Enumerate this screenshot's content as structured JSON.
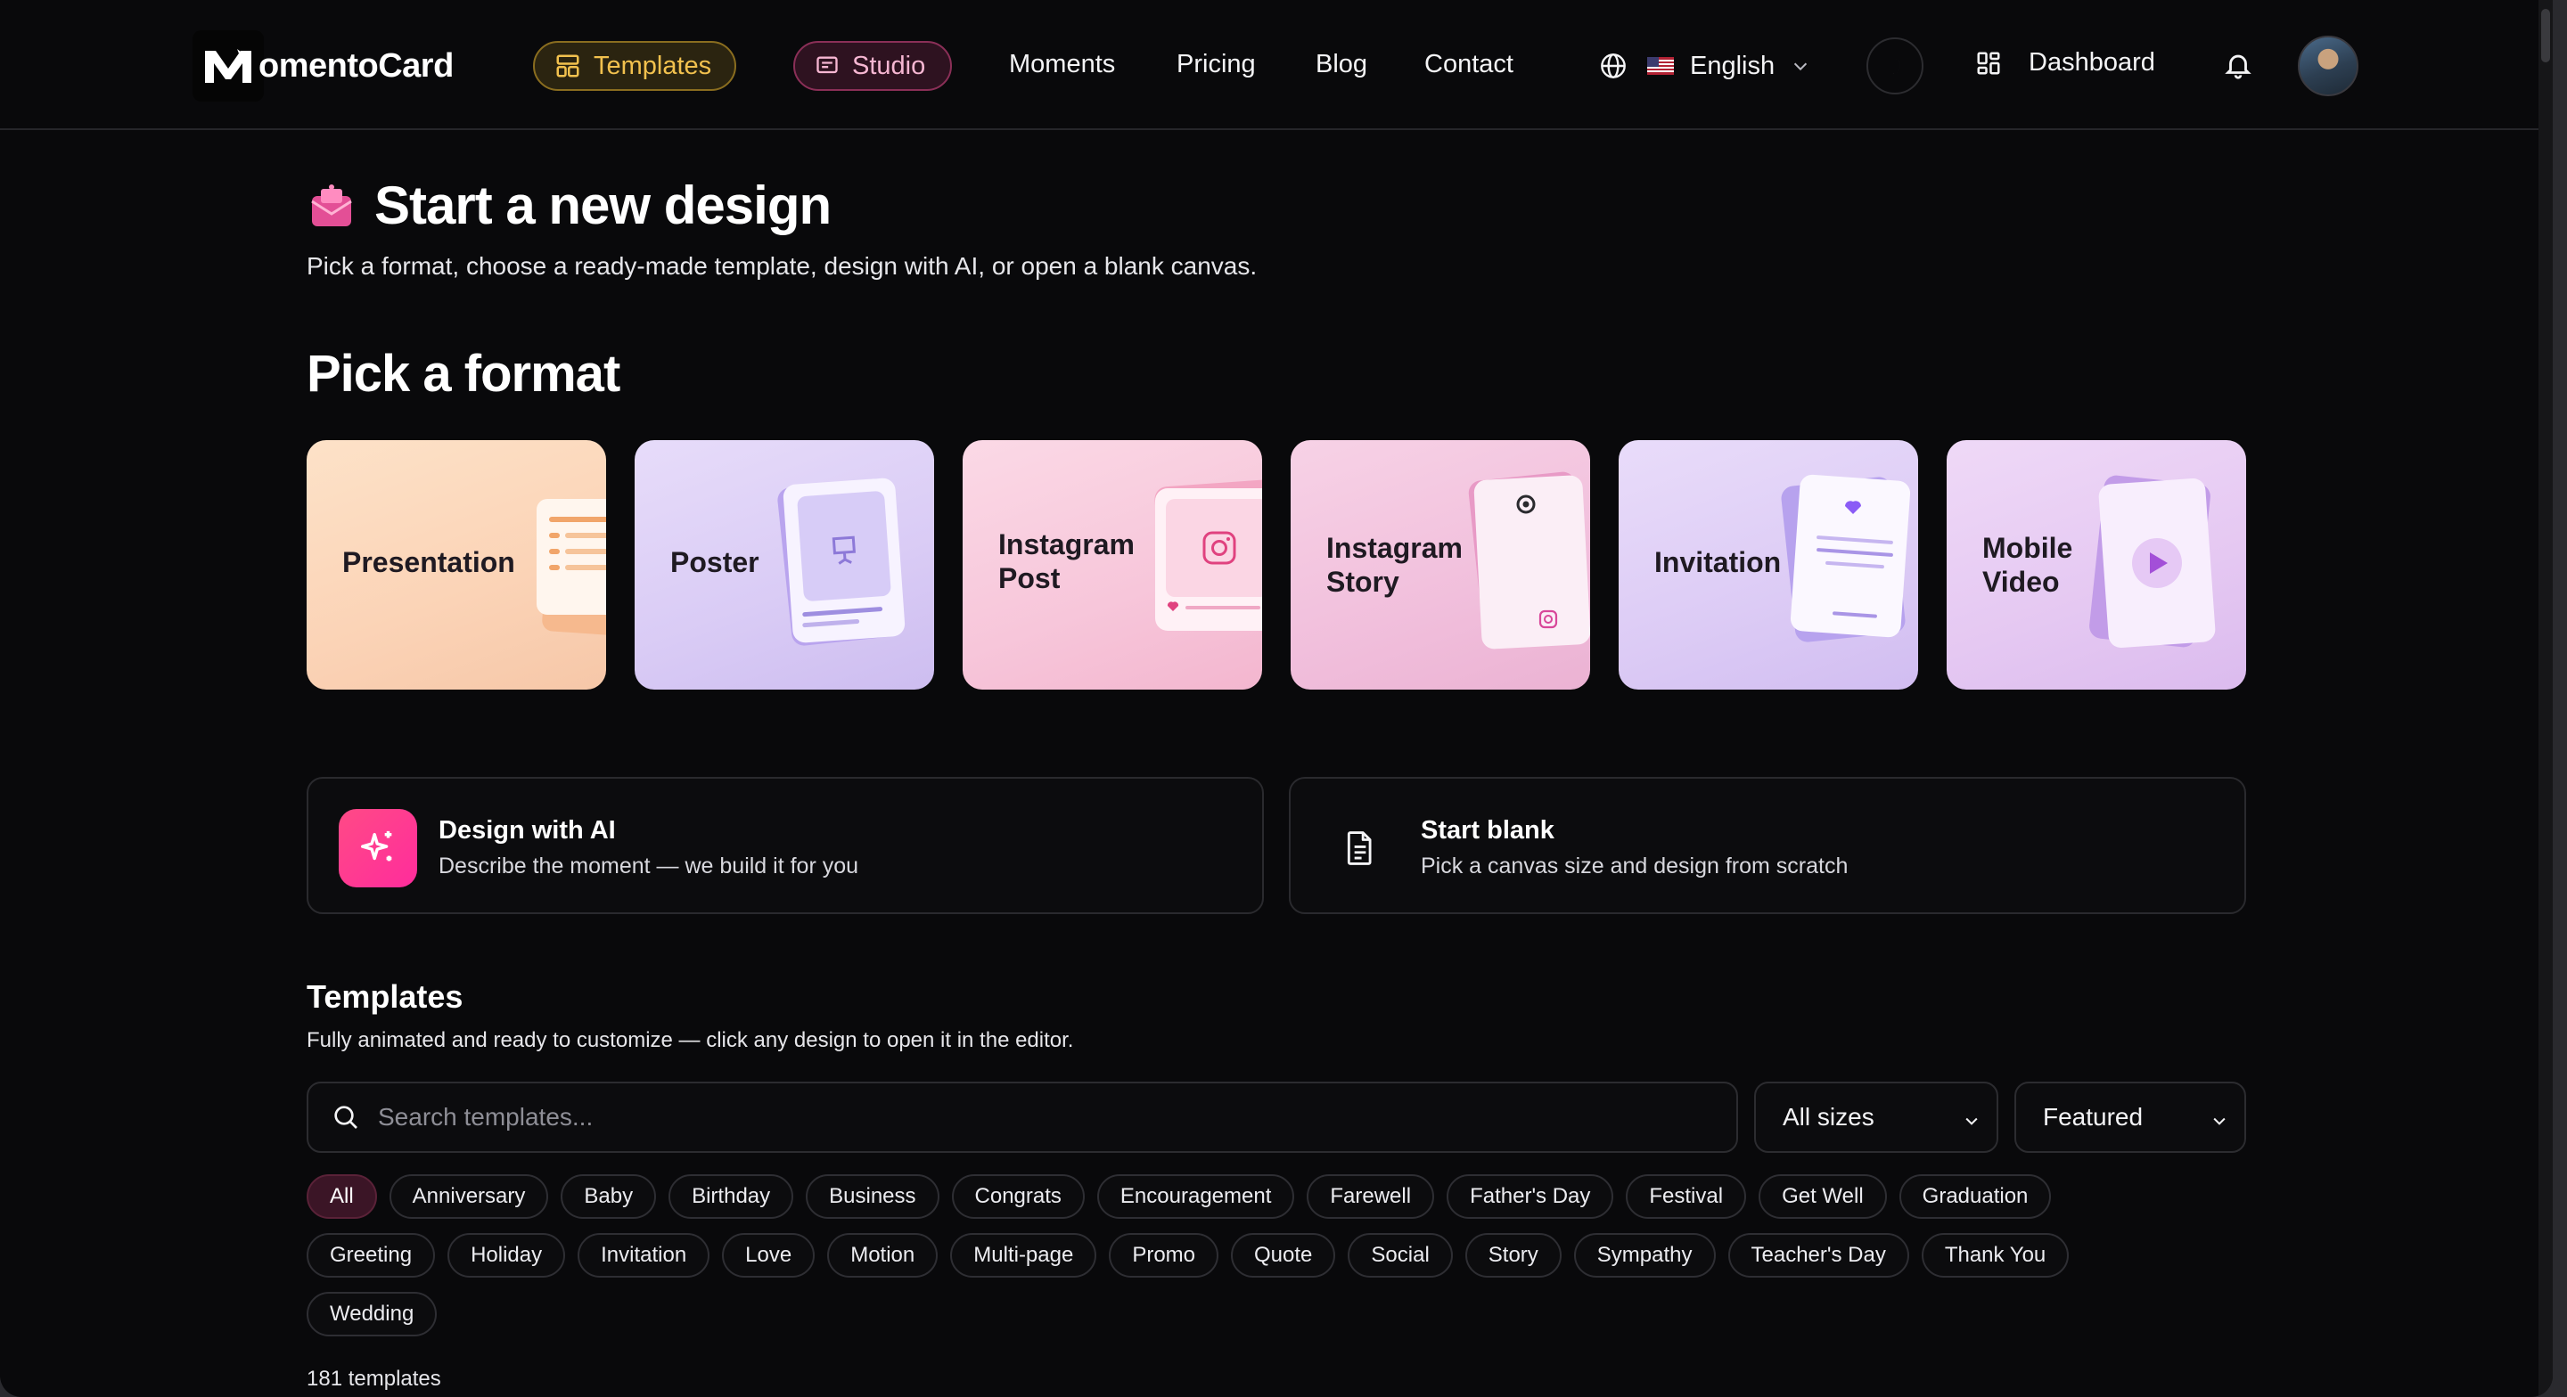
{
  "brand": {
    "name": "omentoCard",
    "logo_letter": "M"
  },
  "nav": {
    "templates": "Templates",
    "studio": "Studio",
    "links": [
      "Moments",
      "Pricing",
      "Blog",
      "Contact"
    ],
    "language": "English",
    "dashboard": "Dashboard"
  },
  "hero": {
    "title": "Start a new design",
    "subtitle": "Pick a format, choose a ready-made template, design with AI, or open a blank canvas."
  },
  "formats": {
    "title": "Pick a format",
    "cards": [
      {
        "label": "Presentation",
        "lines": [
          "Presentation"
        ]
      },
      {
        "label": "Poster",
        "lines": [
          "Poster"
        ]
      },
      {
        "label": "Instagram Post",
        "lines": [
          "Instagram",
          "Post"
        ]
      },
      {
        "label": "Instagram Story",
        "lines": [
          "Instagram",
          "Story"
        ]
      },
      {
        "label": "Invitation",
        "lines": [
          "Invitation"
        ]
      },
      {
        "label": "Mobile Video",
        "lines": [
          "Mobile",
          "Video"
        ]
      }
    ]
  },
  "actions": {
    "ai": {
      "title": "Design with AI",
      "subtitle": "Describe the moment — we build it for you"
    },
    "blank": {
      "title": "Start blank",
      "subtitle": "Pick a canvas size and design from scratch"
    }
  },
  "templates": {
    "title": "Templates",
    "subtitle": "Fully animated and ready to customize — click any design to open it in the editor.",
    "search_placeholder": "Search templates...",
    "size_filter": "All sizes",
    "sort": "Featured",
    "categories": [
      [
        "All",
        "Anniversary",
        "Baby",
        "Birthday",
        "Business",
        "Congrats",
        "Encouragement",
        "Farewell",
        "Father's Day",
        "Festival",
        "Get Well",
        "Graduation"
      ],
      [
        "Greeting",
        "Holiday",
        "Invitation",
        "Love",
        "Motion",
        "Multi-page",
        "Promo",
        "Quote",
        "Social",
        "Story",
        "Sympathy",
        "Teacher's Day",
        "Thank You"
      ],
      [
        "Wedding"
      ]
    ],
    "active_category": "All",
    "count": "181 templates"
  },
  "colors": {
    "background": "#09090b",
    "templates_accent": "#f2c14e",
    "studio_accent": "#f6b6d2",
    "ai_gradient_start": "#ff3d7f",
    "ai_gradient_end": "#ff2e9a"
  }
}
